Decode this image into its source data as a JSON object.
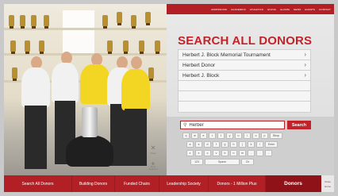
{
  "top_bar": {
    "links": [
      "ADMISSIONS",
      "ACADEMICS",
      "ATHLETICS",
      "GIVING",
      "ALUMNI",
      "NEWS",
      "EVENTS",
      "CONTACT"
    ]
  },
  "page": {
    "title": "SEARCH ALL DONORS"
  },
  "results": [
    {
      "label": "Herbert J. Block Memorial Tournament"
    },
    {
      "label": "Herbert Donor"
    },
    {
      "label": "Herbert J. Block"
    }
  ],
  "search": {
    "value": "Herber",
    "button_label": "Search"
  },
  "keyboard": {
    "row1": [
      "q",
      "w",
      "e",
      "r",
      "t",
      "y",
      "u",
      "i",
      "o",
      "p",
      "Bksp"
    ],
    "row2": [
      "a",
      "s",
      "d",
      "f",
      "g",
      "h",
      "j",
      "k",
      "l",
      "Enter"
    ],
    "row3": [
      "z",
      "x",
      "c",
      "v",
      "b",
      "n",
      "m",
      ",",
      ".",
      "-"
    ],
    "row4_left": "123",
    "row4_space": "Space",
    "row4_right": "Clr"
  },
  "controls": {
    "close_label": "Close",
    "move_label": "Move Keyboard"
  },
  "bottom_nav": {
    "items": [
      {
        "label": "Search All Donors"
      },
      {
        "label": "Building Donors"
      },
      {
        "label": "Funded Chairs"
      },
      {
        "label": "Leadership Society"
      },
      {
        "label": "Donors - 1 Million Plus"
      },
      {
        "label": "Donors"
      }
    ],
    "right_top": "Close",
    "right_bottom": "Home"
  },
  "colors": {
    "accent_red": "#b21f25",
    "title_red": "#c2232a",
    "panel_gray": "#e0e0e0"
  }
}
